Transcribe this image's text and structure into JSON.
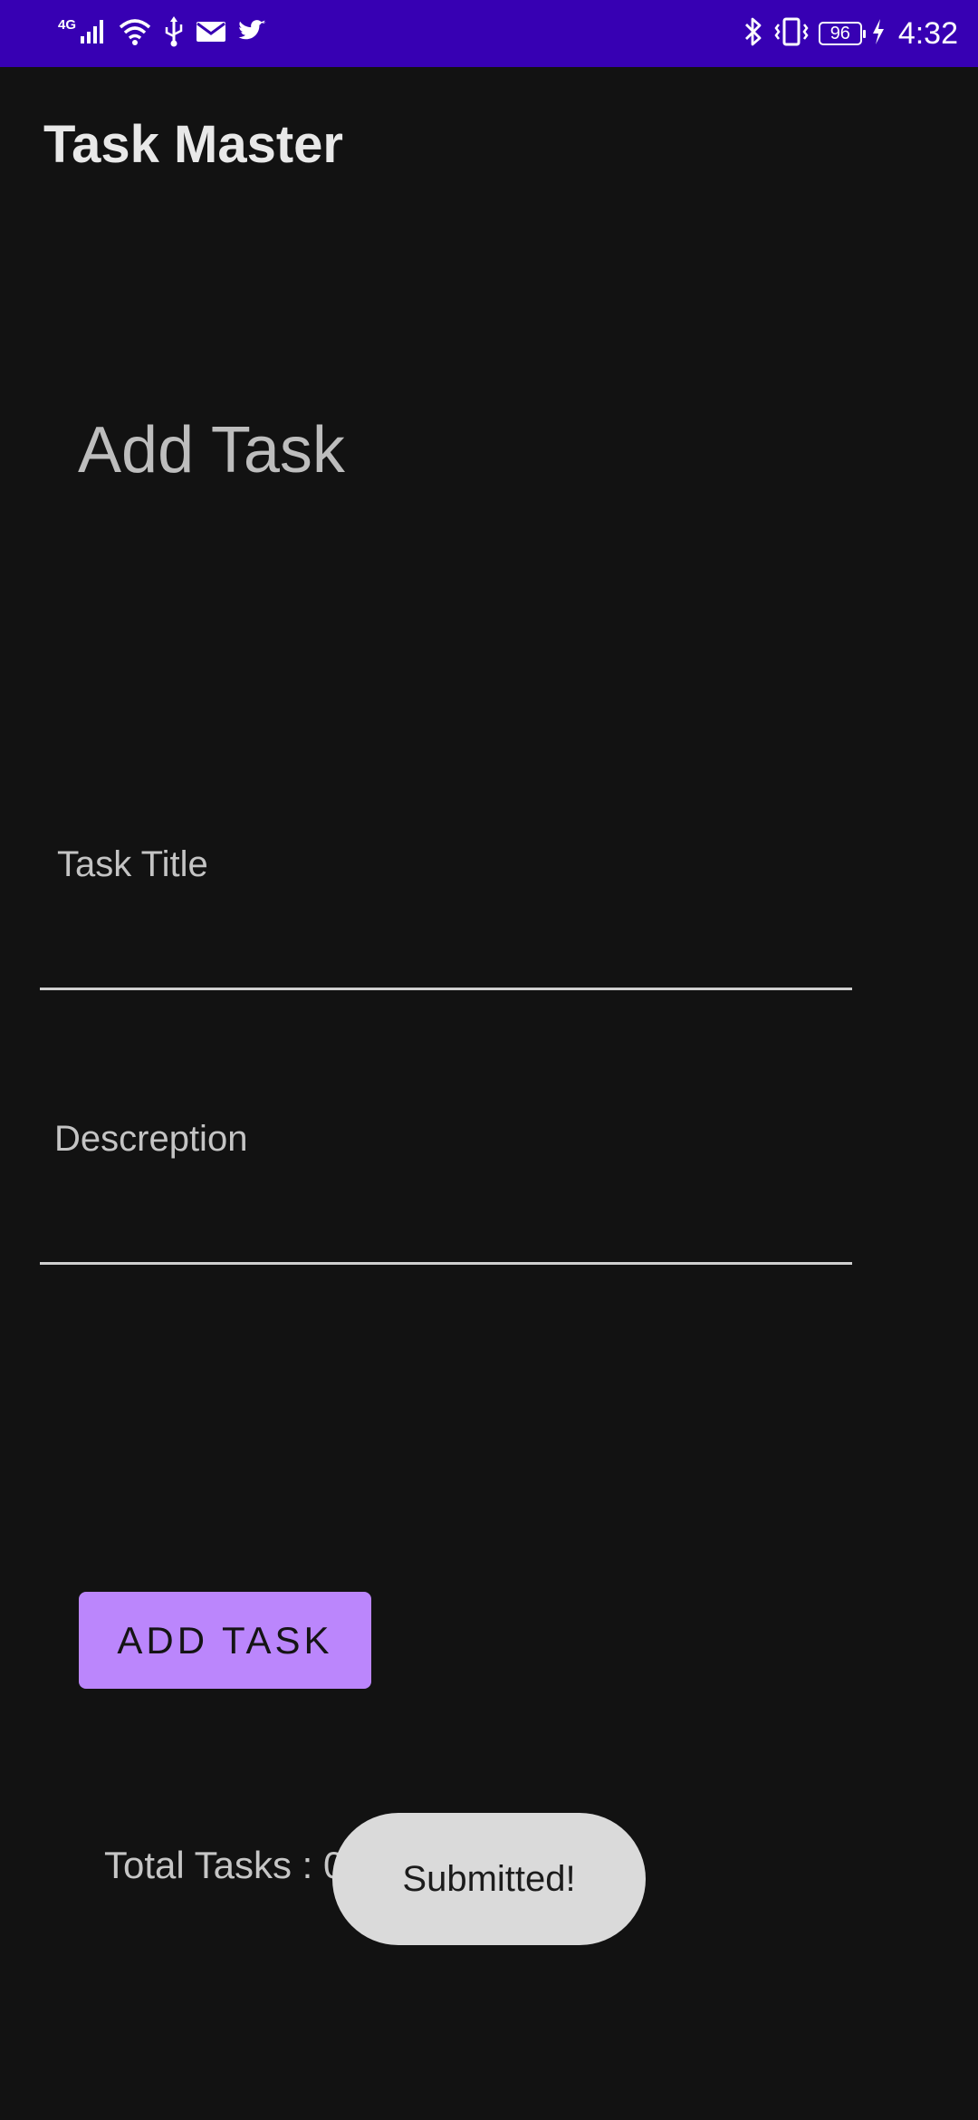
{
  "status_bar": {
    "network_label": "4G",
    "battery_level": "96",
    "time": "4:32"
  },
  "app": {
    "title": "Task Master"
  },
  "form": {
    "heading": "Add Task",
    "title_field": {
      "placeholder": "Task Title",
      "value": ""
    },
    "description_field": {
      "placeholder": "Descreption",
      "value": ""
    },
    "submit_label": "ADD TASK"
  },
  "summary": {
    "total_tasks": "Total Tasks : 0"
  },
  "toast": {
    "message": "Submitted!"
  },
  "colors": {
    "status_bar": "#3700b3",
    "background": "#121212",
    "accent_button": "#bb86fc",
    "toast_background": "#dadada"
  }
}
